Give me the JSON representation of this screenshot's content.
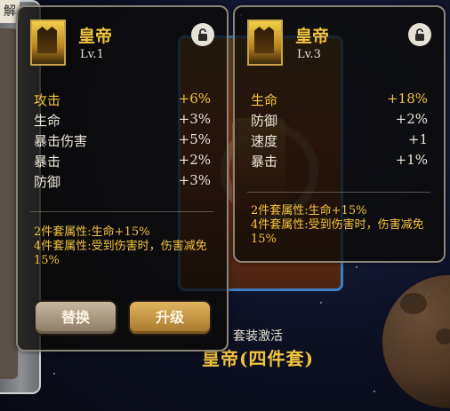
{
  "side_tab": "解",
  "set_panel": {
    "title": "套装激活",
    "name": "皇帝(四件套)"
  },
  "left_card": {
    "name": "皇帝",
    "level": "Lv.1",
    "stats": [
      {
        "name": "攻击",
        "value": "+6%",
        "highlight": true
      },
      {
        "name": "生命",
        "value": "+3%",
        "highlight": false
      },
      {
        "name": "暴击伤害",
        "value": "+5%",
        "highlight": false
      },
      {
        "name": "暴击",
        "value": "+2%",
        "highlight": false
      },
      {
        "name": "防御",
        "value": "+3%",
        "highlight": false
      }
    ],
    "bonus_2": "2件套属性:生命+15%",
    "bonus_4": "4件套属性:受到伤害时，伤害减免15%",
    "buttons": {
      "replace": "替换",
      "upgrade": "升级"
    }
  },
  "right_card": {
    "name": "皇帝",
    "level": "Lv.3",
    "stats": [
      {
        "name": "生命",
        "value": "+18%",
        "highlight": true
      },
      {
        "name": "防御",
        "value": "+2%",
        "highlight": false
      },
      {
        "name": "速度",
        "value": "+1",
        "highlight": false
      },
      {
        "name": "暴击",
        "value": "+1%",
        "highlight": false
      }
    ],
    "bonus_2": "2件套属性:生命+15%",
    "bonus_4": "4件套属性:受到伤害时，伤害减免15%"
  },
  "icons": {
    "lock": "lock-icon",
    "portrait": "emperor-portrait-icon"
  },
  "colors": {
    "gold": "#f2c43e",
    "text": "#ece7da",
    "card_bg": "#0c0a08",
    "card_border": "#8b8679"
  }
}
